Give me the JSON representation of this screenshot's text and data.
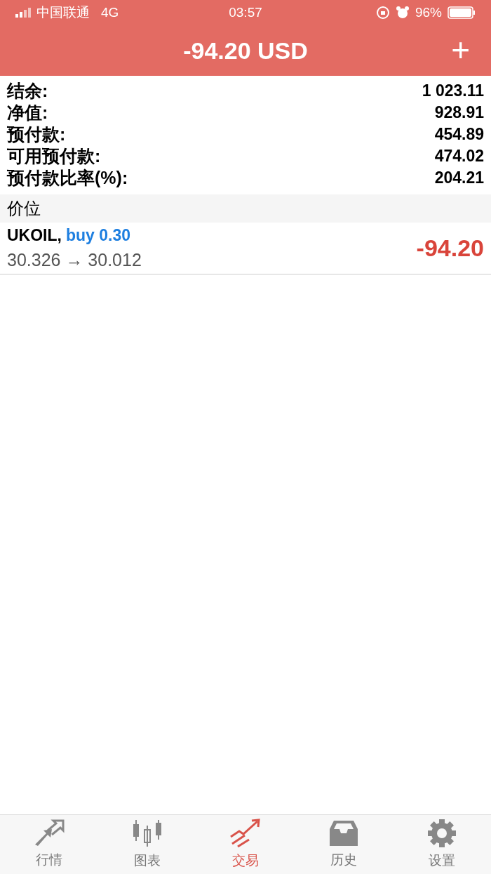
{
  "status_bar": {
    "carrier": "中国联通",
    "network": "4G",
    "time": "03:57",
    "battery": "96%"
  },
  "header": {
    "title": "-94.20 USD",
    "add_button": "+"
  },
  "summary": [
    {
      "label": "结余:",
      "value": "1 023.11"
    },
    {
      "label": "净值:",
      "value": "928.91"
    },
    {
      "label": "预付款:",
      "value": "454.89"
    },
    {
      "label": "可用预付款:",
      "value": "474.02"
    },
    {
      "label": "预付款比率(%):",
      "value": "204.21"
    }
  ],
  "section": {
    "title": "价位"
  },
  "positions": [
    {
      "symbol": "UKOIL,",
      "side": "buy 0.30",
      "prices": "30.326 → 30.012",
      "profit": "-94.20"
    }
  ],
  "tab_bar": [
    {
      "label": "行情",
      "kind": "arrows",
      "selected": false
    },
    {
      "label": "图表",
      "kind": "candles",
      "selected": false
    },
    {
      "label": "交易",
      "kind": "trend",
      "selected": true
    },
    {
      "label": "历史",
      "kind": "inbox",
      "selected": false
    },
    {
      "label": "设置",
      "kind": "gear",
      "selected": false
    }
  ]
}
